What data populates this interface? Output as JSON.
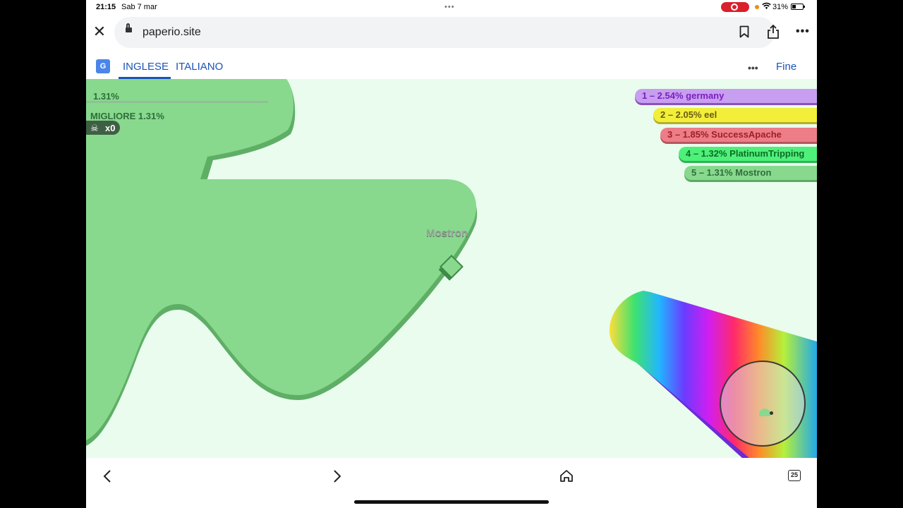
{
  "status_bar": {
    "time": "21:15",
    "date": "Sab 7 mar",
    "battery_percent": "31%",
    "battery_level": 0.31
  },
  "browser": {
    "url": "paperio.site",
    "tabs_count": "25"
  },
  "translate_bar": {
    "source_lang": "INGLESE",
    "target_lang": "ITALIANO",
    "done_label": "Fine"
  },
  "game": {
    "hud": {
      "territory_percent": "1.31%",
      "best_label": "MIGLIORE 1.31%",
      "kills": "x0"
    },
    "player_name": "Mostron",
    "leaderboard": [
      {
        "label": "1 – 2.54% germany",
        "color": "#c79ef0"
      },
      {
        "label": "2 – 2.05% eel",
        "color": "#f2ee3a"
      },
      {
        "label": "3 – 1.85% SuccessApache",
        "color": "#ed7d86"
      },
      {
        "label": "4 – 1.32% PlatinumTripping",
        "color": "#4ff07a"
      },
      {
        "label": "5 – 1.31% Mostron",
        "color": "#88d98e"
      }
    ],
    "colors": {
      "background": "#e9fcee",
      "territory": "#88d98e",
      "territory_edge": "#5fae66"
    }
  }
}
